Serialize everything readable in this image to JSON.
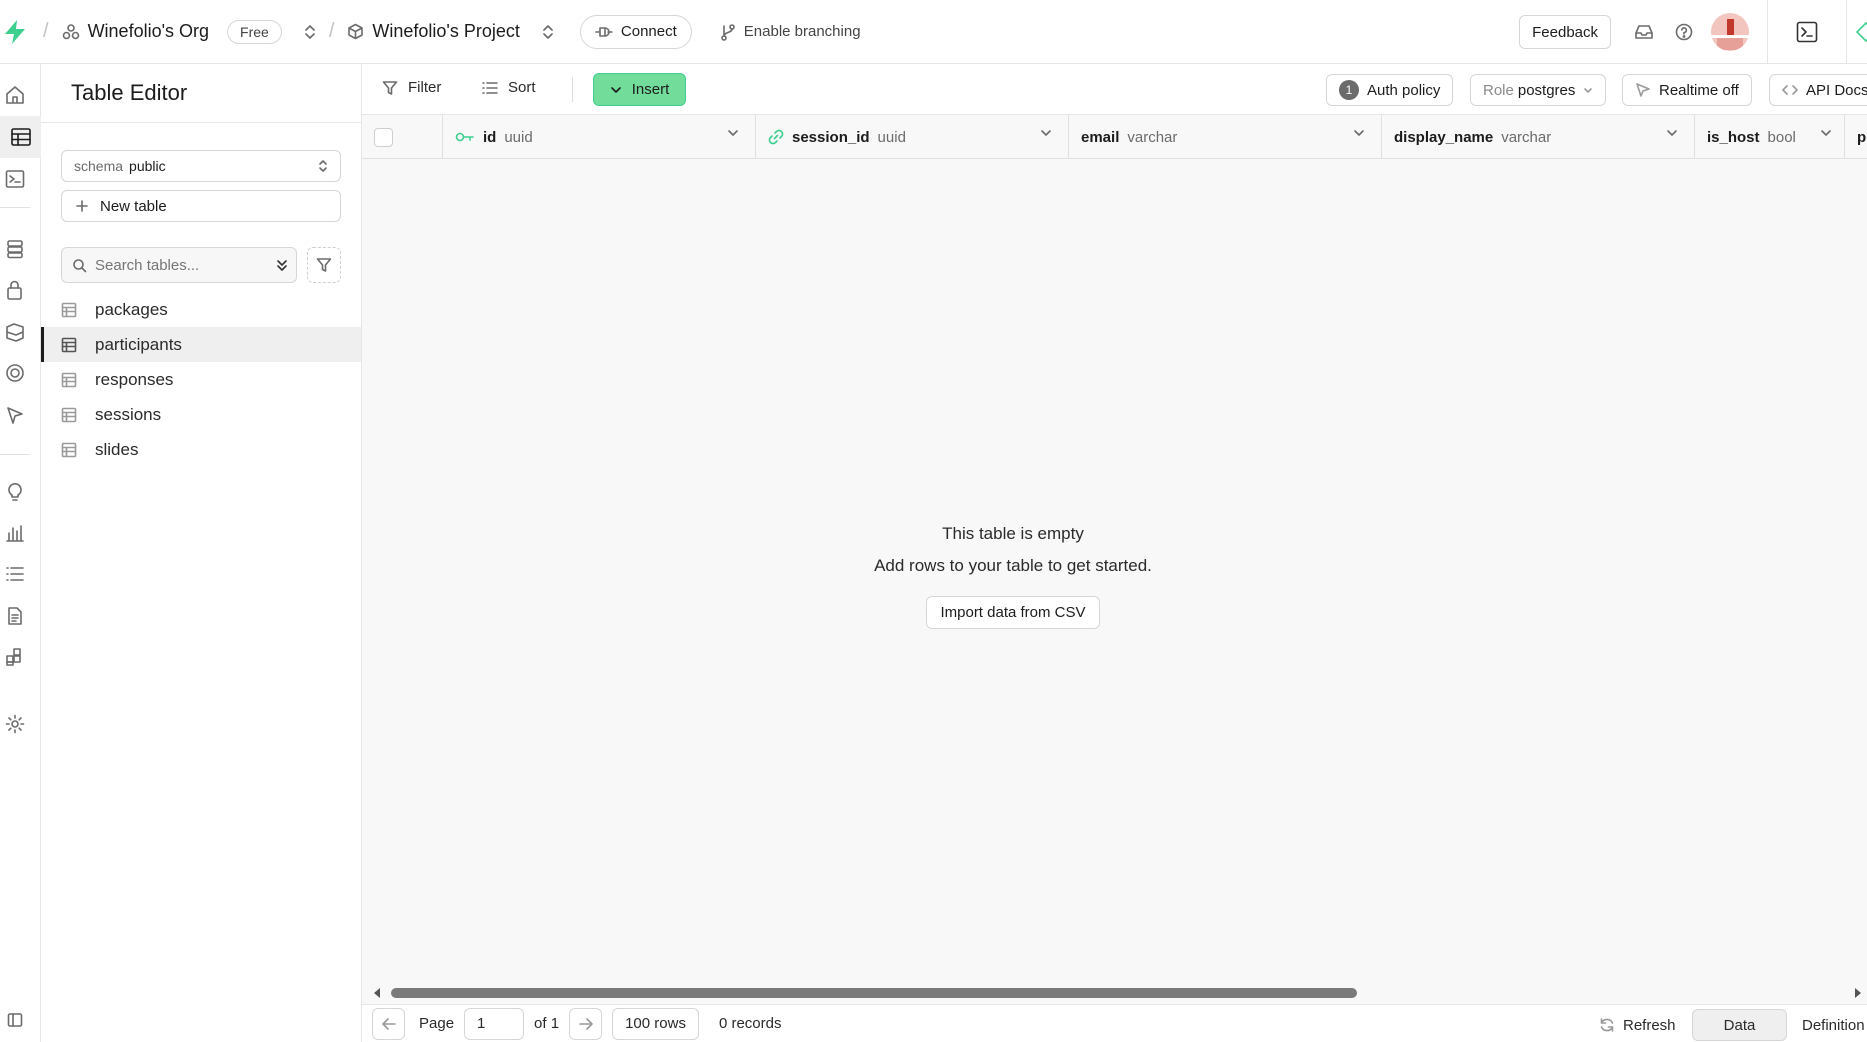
{
  "topbar": {
    "org_name": "Winefolio's Org",
    "plan_badge": "Free",
    "project_name": "Winefolio's Project",
    "connect_label": "Connect",
    "branching_label": "Enable branching",
    "feedback_label": "Feedback"
  },
  "sidebar": {
    "title": "Table Editor",
    "schema_label": "schema",
    "schema_value": "public",
    "new_table_label": "New table",
    "search_placeholder": "Search tables...",
    "tables": [
      {
        "name": "packages",
        "active": false
      },
      {
        "name": "participants",
        "active": true
      },
      {
        "name": "responses",
        "active": false
      },
      {
        "name": "sessions",
        "active": false
      },
      {
        "name": "slides",
        "active": false
      }
    ]
  },
  "toolbar": {
    "filter_label": "Filter",
    "sort_label": "Sort",
    "insert_label": "Insert",
    "auth_policy_count": "1",
    "auth_policy_label": "Auth policy",
    "role_label": "Role",
    "role_value": "postgres",
    "realtime_label": "Realtime off",
    "api_docs_label": "API Docs"
  },
  "columns": [
    {
      "name": "id",
      "type": "uuid",
      "icon": "key-icon"
    },
    {
      "name": "session_id",
      "type": "uuid",
      "icon": "link-icon"
    },
    {
      "name": "email",
      "type": "varchar",
      "icon": ""
    },
    {
      "name": "display_name",
      "type": "varchar",
      "icon": ""
    },
    {
      "name": "is_host",
      "type": "bool",
      "icon": ""
    },
    {
      "name": "pr",
      "type": "",
      "icon": ""
    }
  ],
  "empty_state": {
    "title": "This table is empty",
    "subtitle": "Add rows to your table to get started.",
    "import_label": "Import data from CSV"
  },
  "footer": {
    "page_label": "Page",
    "page_value": "1",
    "of_label": "of 1",
    "rows_label": "100 rows",
    "records_label": "0 records",
    "refresh_label": "Refresh",
    "data_tab": "Data",
    "definition_tab": "Definition"
  },
  "colors": {
    "brand_green": "#3ecf8e",
    "insert_bg": "#72dc9b"
  }
}
